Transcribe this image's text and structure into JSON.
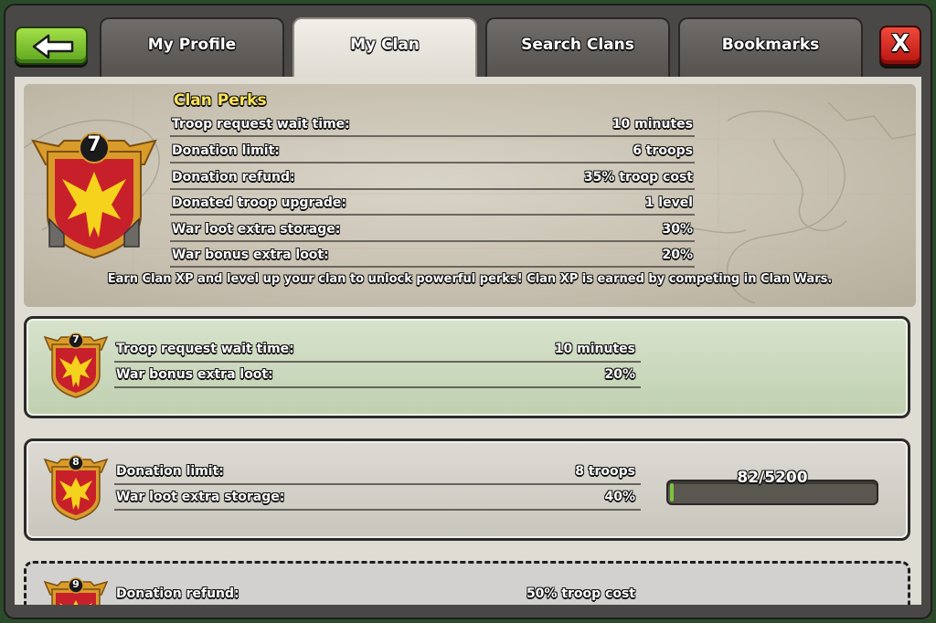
{
  "tabs": [
    {
      "label": "My Profile",
      "active": false
    },
    {
      "label": "My Clan",
      "active": true
    },
    {
      "label": "Search Clans",
      "active": false
    },
    {
      "label": "Bookmarks",
      "active": false
    }
  ],
  "buttons": {
    "back_icon": "arrow-left-icon",
    "close_label": "X"
  },
  "clan_perks": {
    "title": "Clan Perks",
    "clan_level": "7",
    "rows": [
      {
        "label": "Troop request wait time:",
        "value": "10 minutes"
      },
      {
        "label": "Donation limit:",
        "value": "6 troops"
      },
      {
        "label": "Donation refund:",
        "value": "35% troop cost"
      },
      {
        "label": "Donated troop upgrade:",
        "value": "1 level"
      },
      {
        "label": "War loot extra storage:",
        "value": "30%"
      },
      {
        "label": "War bonus extra loot:",
        "value": "20%"
      }
    ],
    "note": "Earn Clan XP and level up your clan to unlock powerful perks! Clan XP is earned by competing in Clan Wars."
  },
  "levels": [
    {
      "level": "7",
      "state": "current",
      "rows": [
        {
          "label": "Troop request wait time:",
          "value": "10 minutes"
        },
        {
          "label": "War bonus extra loot:",
          "value": "20%"
        }
      ]
    },
    {
      "level": "8",
      "state": "next",
      "rows": [
        {
          "label": "Donation limit:",
          "value": "8 troops"
        },
        {
          "label": "War loot extra storage:",
          "value": "40%"
        }
      ],
      "progress": {
        "text": "82/5200",
        "current": 82,
        "max": 5200
      }
    },
    {
      "level": "9",
      "state": "locked",
      "rows": [
        {
          "label": "Donation refund:",
          "value": "50% troop cost"
        }
      ]
    }
  ],
  "colors": {
    "badge_red": "#c8202a",
    "badge_yellow": "#f5d21c",
    "badge_gold": "#d99b2a",
    "progress_green": "#7dc23a",
    "title_yellow": "#ffe55a"
  }
}
